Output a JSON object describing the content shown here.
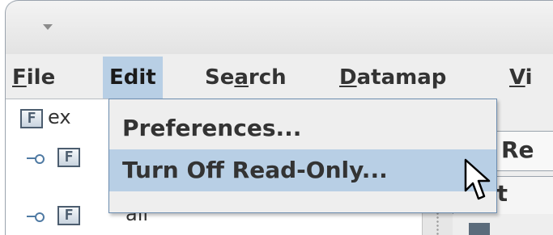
{
  "menubar": {
    "items": [
      {
        "pre": "",
        "mnemonic": "F",
        "post": "ile"
      },
      {
        "pre": "Edit",
        "mnemonic": "",
        "post": ""
      },
      {
        "pre": "Se",
        "mnemonic": "a",
        "post": "rch"
      },
      {
        "pre": "",
        "mnemonic": "D",
        "post": "atamap"
      },
      {
        "pre": "",
        "mnemonic": "V",
        "post": "i"
      }
    ]
  },
  "edit_menu": {
    "items": [
      {
        "label": "Preferences..."
      },
      {
        "label": "Turn Off Read-Only..."
      }
    ]
  },
  "tree": {
    "icon_glyph": "F",
    "rows": [
      {
        "label": "ex"
      },
      {
        "label": ""
      },
      {
        "label": "all"
      }
    ]
  },
  "right_panel": {
    "field_text": "Re",
    "tab_text": "dit"
  },
  "colors": {
    "highlight": "#b8cfe5",
    "menu_bg": "#eeeeee",
    "border": "#6c8db0"
  }
}
